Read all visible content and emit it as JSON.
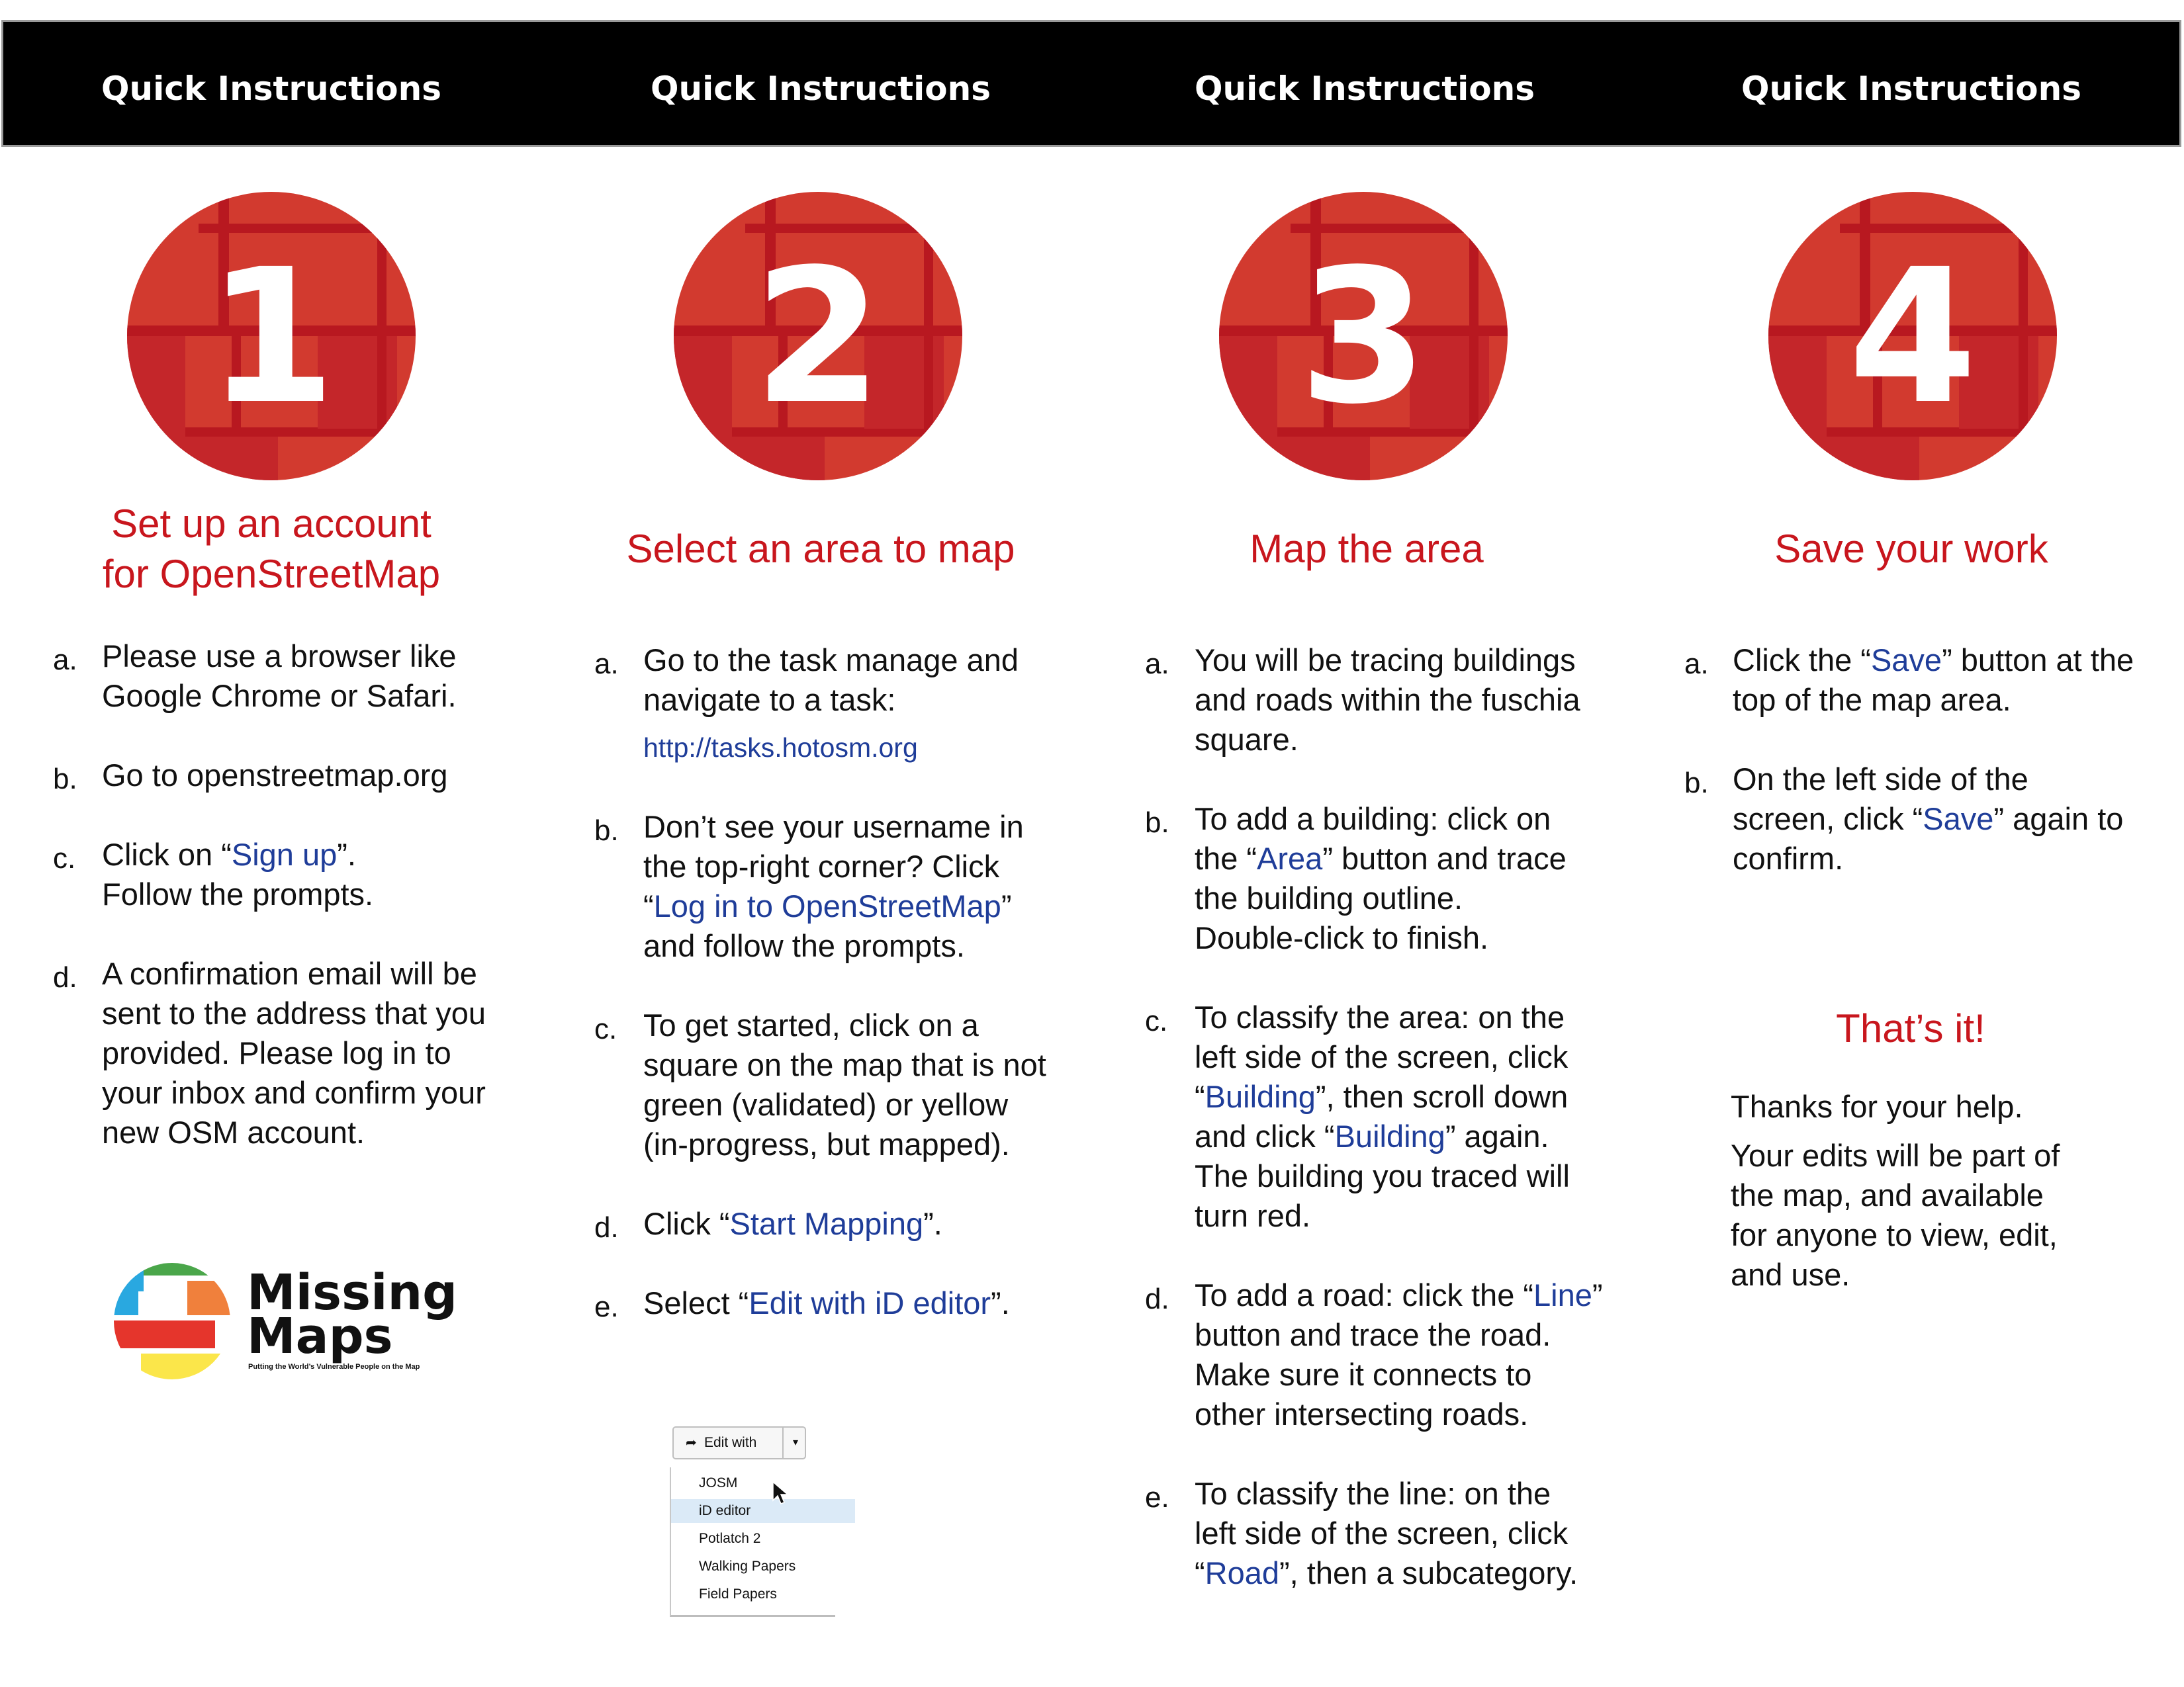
{
  "colors": {
    "header_bg": "#000000",
    "header_text": "#ffffff",
    "accent_red": "#c8161d",
    "badge_red": "#d23a2f",
    "link_blue": "#1f3d99"
  },
  "header_title": "Quick Instructions",
  "steps": [
    {
      "number": "1",
      "heading_lines": [
        "Set up an account",
        "for OpenStreetMap"
      ],
      "items": [
        {
          "marker": "a.",
          "lines": [
            "Please use a browser like",
            "Google Chrome or Safari."
          ]
        },
        {
          "marker": "b.",
          "lines": [
            "Go to openstreetmap.org"
          ]
        },
        {
          "marker": "c.",
          "parts": [
            "Click on “",
            "Sign up",
            "”."
          ],
          "line2": "Follow the prompts."
        },
        {
          "marker": "d.",
          "lines": [
            "A confirmation email will be",
            "sent to the address that you",
            "provided. Please log in to",
            "your inbox and confirm your",
            "new OSM account."
          ]
        }
      ]
    },
    {
      "number": "2",
      "heading_lines": [
        "Select an area to map"
      ],
      "items": [
        {
          "marker": "a.",
          "lines": [
            "Go to the task manage and",
            "navigate to a task:"
          ],
          "link": "http://tasks.hotosm.org"
        },
        {
          "marker": "b.",
          "lines": [
            "Don’t see your username in",
            "the top-right corner? Click"
          ],
          "parts": [
            "“",
            "Log in to OpenStreetMap",
            "”"
          ],
          "line_after": "and follow the prompts."
        },
        {
          "marker": "c.",
          "lines": [
            "To get started, click on a",
            "square on the map that is not",
            "green (validated) or yellow",
            "(in-progress, but mapped)."
          ]
        },
        {
          "marker": "d.",
          "parts": [
            "Click “",
            "Start Mapping",
            "”."
          ]
        },
        {
          "marker": "e.",
          "parts": [
            "Select “",
            "Edit with iD editor",
            "”."
          ]
        }
      ]
    },
    {
      "number": "3",
      "heading_lines": [
        "Map the area"
      ],
      "items": [
        {
          "marker": "a.",
          "lines": [
            "You will be tracing buildings",
            "and roads within the fuschia",
            "square."
          ]
        },
        {
          "marker": "b.",
          "l1": "To add a building: click on",
          "parts": [
            "the “",
            "Area",
            "” button and trace"
          ],
          "lines_after": [
            "the building outline.",
            "Double-click to finish."
          ]
        },
        {
          "marker": "c.",
          "l1": "To classify the area: on the",
          "l2": "left side of the screen, click",
          "parts": [
            "“",
            "Building",
            "”, then scroll down"
          ],
          "parts2": [
            "and click “",
            "Building",
            "” again."
          ],
          "lines_after": [
            "The building you traced will",
            "turn red."
          ]
        },
        {
          "marker": "d.",
          "parts": [
            "To add a road: click the “",
            "Line",
            "”"
          ],
          "lines_after": [
            "button and trace the road.",
            "Make sure it connects to",
            "other intersecting roads."
          ]
        },
        {
          "marker": "e.",
          "l1": "To classify the line: on the",
          "l2": "left side of the screen, click",
          "parts": [
            "“",
            "Road",
            "”, then a subcategory."
          ]
        }
      ]
    },
    {
      "number": "4",
      "heading_lines": [
        "Save your work"
      ],
      "items": [
        {
          "marker": "a.",
          "parts": [
            "Click the “",
            "Save",
            "” button at the"
          ],
          "lines_after": [
            "top of the map area."
          ]
        },
        {
          "marker": "b.",
          "l1": "On the left side of the",
          "parts": [
            "screen, click “",
            "Save",
            "” again to"
          ],
          "lines_after": [
            "confirm."
          ]
        }
      ],
      "closing_heading": "That’s it!",
      "closing_lines_1": [
        "Thanks for your help."
      ],
      "closing_lines_2": [
        "Your edits will be part of",
        "the map, and available",
        "for anyone to view, edit,",
        "and use."
      ]
    }
  ],
  "brand": {
    "line1": "Missing",
    "line2": "Maps",
    "tagline": "Putting the World’s Vulnerable People on the Map"
  },
  "edit_menu": {
    "button_label": "Edit with",
    "button_icon": "share-arrow-icon",
    "options": [
      "JOSM",
      "iD editor",
      "Potlatch 2",
      "Walking Papers",
      "Field Papers"
    ],
    "selected": "iD editor"
  }
}
